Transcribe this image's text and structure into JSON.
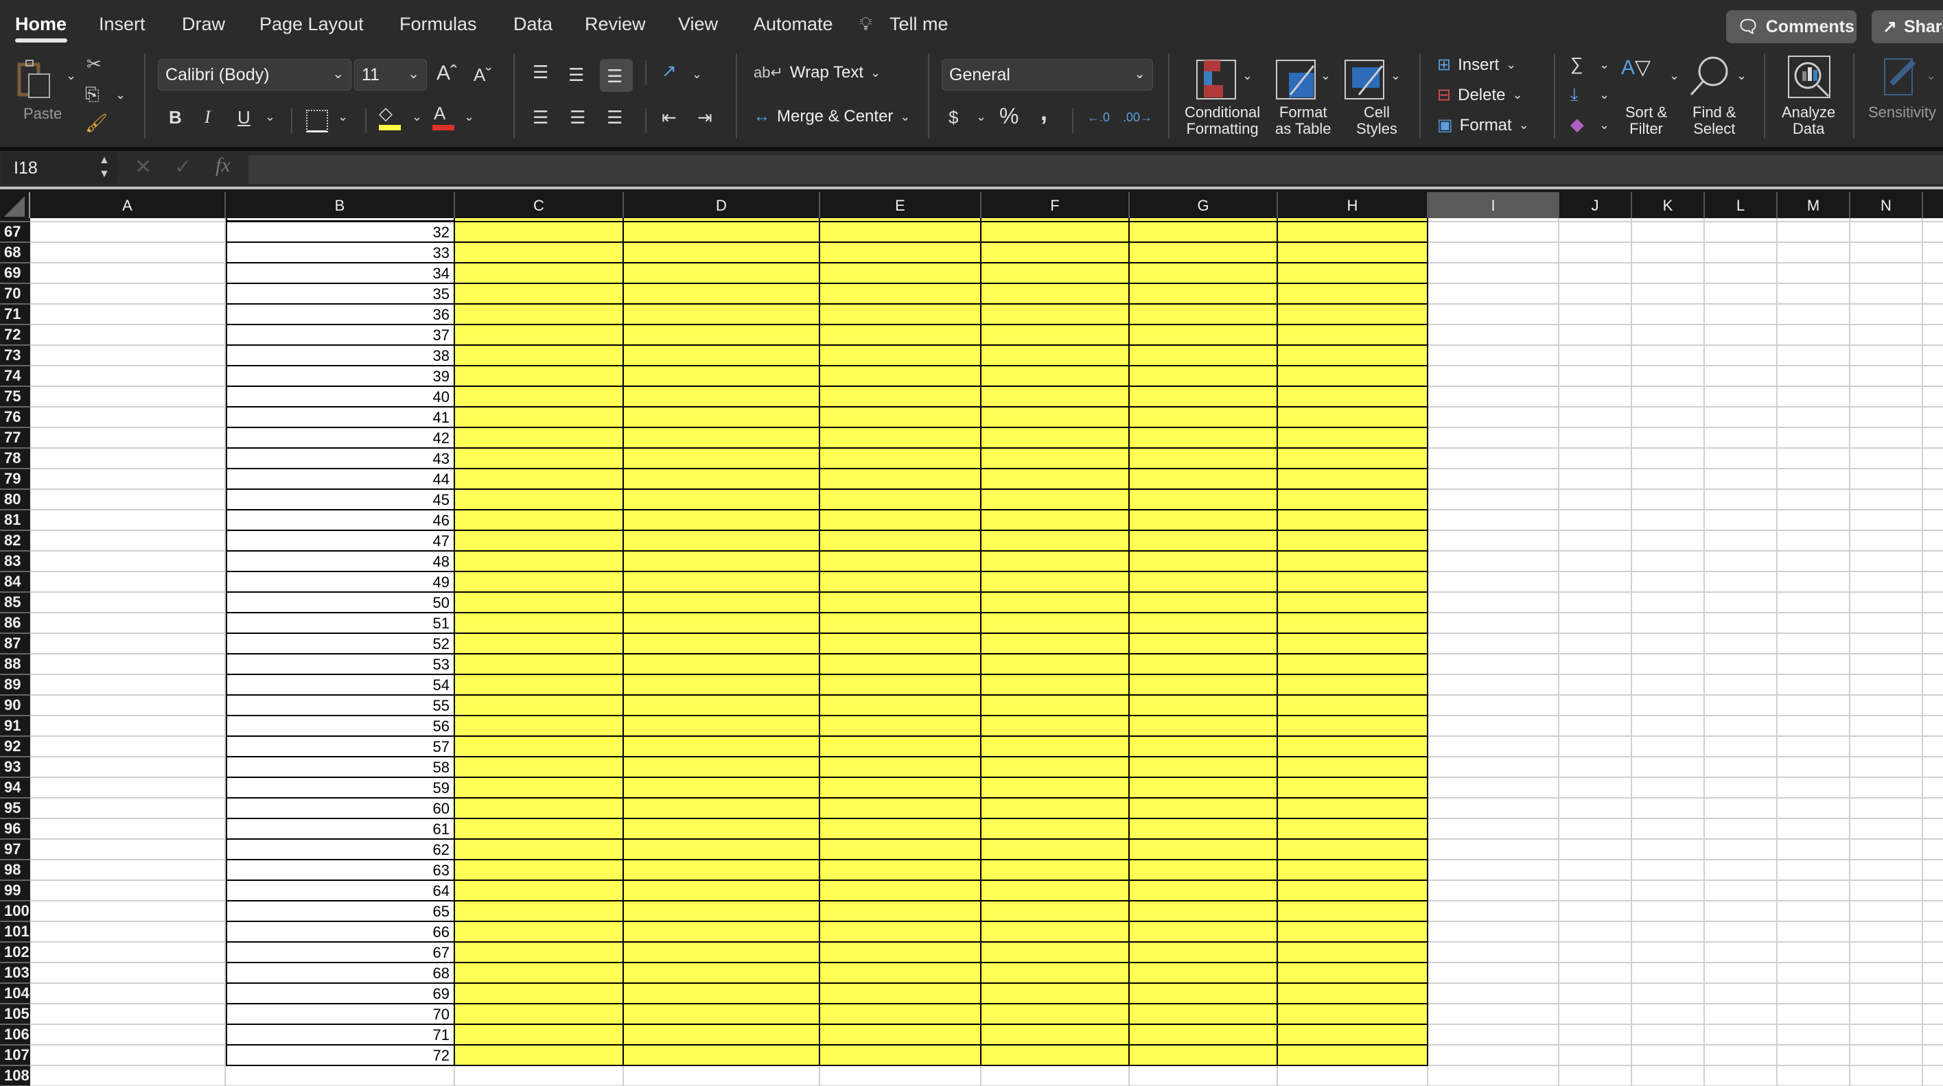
{
  "tabs": [
    {
      "label": "Home",
      "active": true
    },
    {
      "label": "Insert"
    },
    {
      "label": "Draw"
    },
    {
      "label": "Page Layout"
    },
    {
      "label": "Formulas"
    },
    {
      "label": "Data"
    },
    {
      "label": "Review"
    },
    {
      "label": "View"
    },
    {
      "label": "Automate"
    }
  ],
  "tell_me": "Tell me",
  "top_buttons": {
    "comments": "Comments",
    "share": "Share"
  },
  "ribbon": {
    "paste": "Paste",
    "font_name": "Calibri (Body)",
    "font_size": "11",
    "bold": "B",
    "italic": "I",
    "underline": "U",
    "wrap_text": "Wrap Text",
    "merge_center": "Merge & Center",
    "number_format": "General",
    "currency": "$",
    "percent": "%",
    "comma": ",",
    "conditional_formatting": [
      "Conditional",
      "Formatting"
    ],
    "format_as_table": [
      "Format",
      "as Table"
    ],
    "cell_styles": [
      "Cell",
      "Styles"
    ],
    "insert": "Insert",
    "delete": "Delete",
    "format": "Format",
    "sort_filter": [
      "Sort &",
      "Filter"
    ],
    "find_select": [
      "Find &",
      "Select"
    ],
    "analyze_data": [
      "Analyze",
      "Data"
    ],
    "sensitivity": "Sensitivity"
  },
  "colors": {
    "highlight": "#ffff55",
    "font_color": "#e0302a",
    "fill_color": "#ffff44",
    "selected_col": "#5a5a5a"
  },
  "formula_bar": {
    "name_box": "I18",
    "fx": "fx",
    "value": ""
  },
  "columns": [
    "A",
    "B",
    "C",
    "D",
    "E",
    "F",
    "G",
    "H",
    "I",
    "J",
    "K",
    "L",
    "M",
    "N"
  ],
  "selected_column": "I",
  "rows": {
    "numbers": [
      67,
      68,
      69,
      70,
      71,
      72,
      73,
      74,
      75,
      76,
      77,
      78,
      79,
      80,
      81,
      82,
      83,
      84,
      85,
      86,
      87,
      88,
      89,
      90,
      91,
      92,
      93,
      94,
      95,
      96,
      97,
      98,
      99,
      100,
      101,
      102,
      103,
      104,
      105,
      106,
      107,
      108
    ],
    "col_b_values": [
      32,
      33,
      34,
      35,
      36,
      37,
      38,
      39,
      40,
      41,
      42,
      43,
      44,
      45,
      46,
      47,
      48,
      49,
      50,
      51,
      52,
      53,
      54,
      55,
      56,
      57,
      58,
      59,
      60,
      61,
      62,
      63,
      64,
      65,
      66,
      67,
      68,
      69,
      70,
      71,
      72,
      null
    ]
  }
}
